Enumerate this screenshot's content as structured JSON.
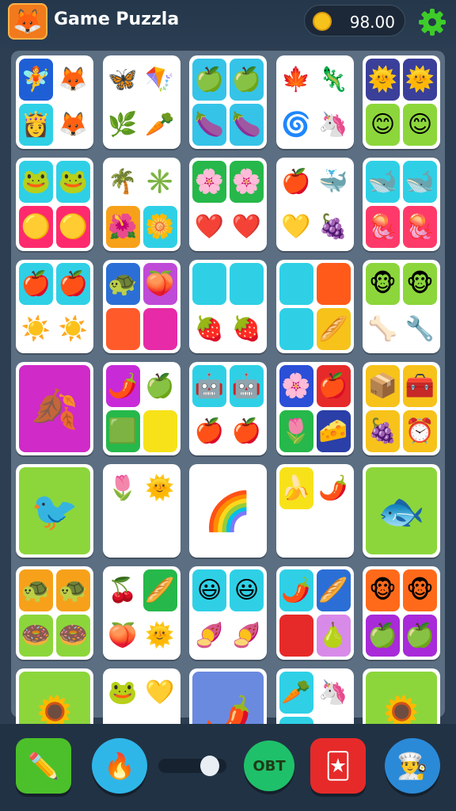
{
  "header": {
    "title": "Game Puzzla",
    "coins": "98.00",
    "logo_icon": "fox-face-icon",
    "coin_icon": "coin-icon",
    "settings_icon": "gear-icon"
  },
  "board": {
    "rows": [
      [
        {
          "type": "quad",
          "tiles": [
            {
              "bg": "#1f5fd6",
              "g": "🧚"
            },
            {
              "bg": "#ffffff",
              "g": "🦊"
            },
            {
              "bg": "#2fd0e6",
              "g": "👸"
            },
            {
              "bg": "#ffffff",
              "g": "🦊"
            }
          ]
        },
        {
          "type": "quad",
          "tiles": [
            {
              "bg": "#ffffff",
              "g": "🦋"
            },
            {
              "bg": "#ffffff",
              "g": "🪁"
            },
            {
              "bg": "#ffffff",
              "g": "🌿"
            },
            {
              "bg": "#ffffff",
              "g": "🥕"
            }
          ]
        },
        {
          "type": "quad",
          "tiles": [
            {
              "bg": "#35c3e8",
              "g": "🍏"
            },
            {
              "bg": "#35c3e8",
              "g": "🍏"
            },
            {
              "bg": "#35c3e8",
              "g": "🍆"
            },
            {
              "bg": "#35c3e8",
              "g": "🍆"
            }
          ]
        },
        {
          "type": "quad",
          "tiles": [
            {
              "bg": "#ffffff",
              "g": "🍁"
            },
            {
              "bg": "#ffffff",
              "g": "🦎"
            },
            {
              "bg": "#ffffff",
              "g": "🌀"
            },
            {
              "bg": "#ffffff",
              "g": "🦄"
            }
          ]
        },
        {
          "type": "quad",
          "tiles": [
            {
              "bg": "#3a3f9a",
              "g": "🌞"
            },
            {
              "bg": "#3a3f9a",
              "g": "🌞"
            },
            {
              "bg": "#8cd63b",
              "g": "😊"
            },
            {
              "bg": "#8cd63b",
              "g": "😊"
            }
          ]
        }
      ],
      [
        {
          "type": "quad",
          "tiles": [
            {
              "bg": "#2fd0e6",
              "g": "🐸"
            },
            {
              "bg": "#2fd0e6",
              "g": "🐸"
            },
            {
              "bg": "#ff2a6e",
              "g": "🟡"
            },
            {
              "bg": "#ff2a6e",
              "g": "🟡"
            }
          ]
        },
        {
          "type": "quad",
          "tiles": [
            {
              "bg": "#ffffff",
              "g": "🌴"
            },
            {
              "bg": "#ffffff",
              "g": "✳️"
            },
            {
              "bg": "#f7a11a",
              "g": "🌺"
            },
            {
              "bg": "#2fd0e6",
              "g": "🌼"
            }
          ]
        },
        {
          "type": "quad",
          "tiles": [
            {
              "bg": "#26b84a",
              "g": "🌸"
            },
            {
              "bg": "#26b84a",
              "g": "🌸"
            },
            {
              "bg": "#ffffff",
              "g": "❤️"
            },
            {
              "bg": "#ffffff",
              "g": "❤️"
            }
          ]
        },
        {
          "type": "quad",
          "tiles": [
            {
              "bg": "#ffffff",
              "g": "🍎"
            },
            {
              "bg": "#ffffff",
              "g": "🐳"
            },
            {
              "bg": "#ffffff",
              "g": "💛"
            },
            {
              "bg": "#ffffff",
              "g": "🍇"
            }
          ]
        },
        {
          "type": "quad",
          "tiles": [
            {
              "bg": "#2fd0e6",
              "g": "🐋"
            },
            {
              "bg": "#2fd0e6",
              "g": "🐋"
            },
            {
              "bg": "#ff3a6a",
              "g": "🪼"
            },
            {
              "bg": "#ff3a6a",
              "g": "🪼"
            }
          ]
        }
      ],
      [
        {
          "type": "quad",
          "tiles": [
            {
              "bg": "#2fd0e6",
              "g": "🍎"
            },
            {
              "bg": "#2fd0e6",
              "g": "🍎"
            },
            {
              "bg": "#ffffff",
              "g": "☀️"
            },
            {
              "bg": "#ffffff",
              "g": "☀️"
            }
          ]
        },
        {
          "type": "quad",
          "tiles": [
            {
              "bg": "#2b6fd6",
              "g": "🐢"
            },
            {
              "bg": "#c04ad8",
              "g": "🍑"
            },
            {
              "bg": "#ff5a2a",
              "g": ""
            },
            {
              "bg": "#e62aa8",
              "g": ""
            }
          ]
        },
        {
          "type": "quad",
          "tiles": [
            {
              "bg": "#2fd0e6",
              "g": ""
            },
            {
              "bg": "#2fd0e6",
              "g": ""
            },
            {
              "bg": "#ffffff",
              "g": "🍓"
            },
            {
              "bg": "#ffffff",
              "g": "🍓"
            }
          ]
        },
        {
          "type": "quad",
          "tiles": [
            {
              "bg": "#2fd0e6",
              "g": ""
            },
            {
              "bg": "#ff5a1a",
              "g": ""
            },
            {
              "bg": "#2fd0e6",
              "g": ""
            },
            {
              "bg": "#f7c21a",
              "g": "🥖"
            }
          ]
        },
        {
          "type": "quad",
          "tiles": [
            {
              "bg": "#8cd63b",
              "g": "🐵"
            },
            {
              "bg": "#8cd63b",
              "g": "🐵"
            },
            {
              "bg": "#ffffff",
              "g": "🦴"
            },
            {
              "bg": "#ffffff",
              "g": "🔧"
            }
          ]
        }
      ],
      [
        {
          "type": "lone",
          "bg": "#d02ac8",
          "g": "🍂"
        },
        {
          "type": "quad",
          "tiles": [
            {
              "bg": "#c82ad8",
              "g": "🌶️"
            },
            {
              "bg": "#ffffff",
              "g": "🍏"
            },
            {
              "bg": "#26b84a",
              "g": "🟩"
            },
            {
              "bg": "#f7e21a",
              "g": ""
            }
          ]
        },
        {
          "type": "quad",
          "tiles": [
            {
              "bg": "#2fd0e6",
              "g": "🤖"
            },
            {
              "bg": "#2fd0e6",
              "g": "🤖"
            },
            {
              "bg": "#ffffff",
              "g": "🍎"
            },
            {
              "bg": "#ffffff",
              "g": "🍎"
            }
          ]
        },
        {
          "type": "quad",
          "tiles": [
            {
              "bg": "#2b4fd6",
              "g": "🌸"
            },
            {
              "bg": "#e62a2a",
              "g": "🍎"
            },
            {
              "bg": "#26b84a",
              "g": "🌷"
            },
            {
              "bg": "#2b3fa8",
              "g": "🧀"
            }
          ]
        },
        {
          "type": "quad",
          "tiles": [
            {
              "bg": "#f7c21a",
              "g": "📦"
            },
            {
              "bg": "#f7c21a",
              "g": "🧰"
            },
            {
              "bg": "#f7c21a",
              "g": "🍇"
            },
            {
              "bg": "#f7c21a",
              "g": "⏰"
            }
          ]
        }
      ],
      [
        {
          "type": "lone",
          "bg": "#8cd63b",
          "g": "🐦"
        },
        {
          "type": "quad",
          "tiles": [
            {
              "bg": "#ffffff",
              "g": "🌷"
            },
            {
              "bg": "#ffffff",
              "g": "🌞"
            },
            {
              "bg": "#ffffff",
              "g": ""
            },
            {
              "bg": "#ffffff",
              "g": ""
            }
          ]
        },
        {
          "type": "lone",
          "bg": "#ffffff",
          "g": "🌈"
        },
        {
          "type": "quad",
          "tiles": [
            {
              "bg": "#f7e21a",
              "g": "🍌"
            },
            {
              "bg": "#ffffff",
              "g": "🌶️"
            },
            {
              "bg": "#ffffff",
              "g": ""
            },
            {
              "bg": "#ffffff",
              "g": ""
            }
          ]
        },
        {
          "type": "lone",
          "bg": "#8cd63b",
          "g": "🐟"
        }
      ],
      [
        {
          "type": "quad",
          "tiles": [
            {
              "bg": "#f7a11a",
              "g": "🐢"
            },
            {
              "bg": "#f7a11a",
              "g": "🐢"
            },
            {
              "bg": "#8cd63b",
              "g": "🍩"
            },
            {
              "bg": "#8cd63b",
              "g": "🍩"
            }
          ]
        },
        {
          "type": "quad",
          "tiles": [
            {
              "bg": "#ffffff",
              "g": "🍒"
            },
            {
              "bg": "#26b84a",
              "g": "🥖"
            },
            {
              "bg": "#ffffff",
              "g": "🍑"
            },
            {
              "bg": "#ffffff",
              "g": "🌞"
            }
          ]
        },
        {
          "type": "quad",
          "tiles": [
            {
              "bg": "#2fd0e6",
              "g": "😃"
            },
            {
              "bg": "#2fd0e6",
              "g": "😃"
            },
            {
              "bg": "#ffffff",
              "g": "🍠"
            },
            {
              "bg": "#ffffff",
              "g": "🍠"
            }
          ]
        },
        {
          "type": "quad",
          "tiles": [
            {
              "bg": "#2fd0e6",
              "g": "🌶️"
            },
            {
              "bg": "#2b6fd6",
              "g": "🥖"
            },
            {
              "bg": "#e62a2a",
              "g": ""
            },
            {
              "bg": "#d88ae8",
              "g": "🍐"
            }
          ]
        },
        {
          "type": "quad",
          "tiles": [
            {
              "bg": "#ff6a1a",
              "g": "🐵"
            },
            {
              "bg": "#ff6a1a",
              "g": "🐵"
            },
            {
              "bg": "#a82ad8",
              "g": "🍏"
            },
            {
              "bg": "#a82ad8",
              "g": "🍏"
            }
          ]
        }
      ],
      [
        {
          "type": "lone",
          "bg": "#8cd63b",
          "g": "🌻"
        },
        {
          "type": "quad",
          "tiles": [
            {
              "bg": "#ffffff",
              "g": "🐸"
            },
            {
              "bg": "#ffffff",
              "g": "💛"
            },
            {
              "bg": "#ffffff",
              "g": "🐸"
            },
            {
              "bg": "#ffffff",
              "g": "💛"
            }
          ]
        },
        {
          "type": "lone",
          "bg": "#6a8ae0",
          "g": "🌶️"
        },
        {
          "type": "quad",
          "tiles": [
            {
              "bg": "#2fd0e6",
              "g": "🥕"
            },
            {
              "bg": "#ffffff",
              "g": "🦄"
            },
            {
              "bg": "#2fd0e6",
              "g": "🥕"
            },
            {
              "bg": "#ffffff",
              "g": "🦄"
            }
          ]
        },
        {
          "type": "lone",
          "bg": "#8cd63b",
          "g": "🌻"
        }
      ]
    ]
  },
  "toolbar": {
    "pencil_icon": "pencil-icon",
    "flame_icon": "flame-icon",
    "toggle_level": 0.85,
    "ok_label": "OBT",
    "card_icon": "card-icon",
    "chef_icon": "chef-hat-icon",
    "colors": {
      "pencil": "#4cc02a",
      "flame": "#2fb6e8",
      "ok": "#1fc06a",
      "card": "#e62a2a",
      "chef": "#2a8ad8"
    }
  }
}
